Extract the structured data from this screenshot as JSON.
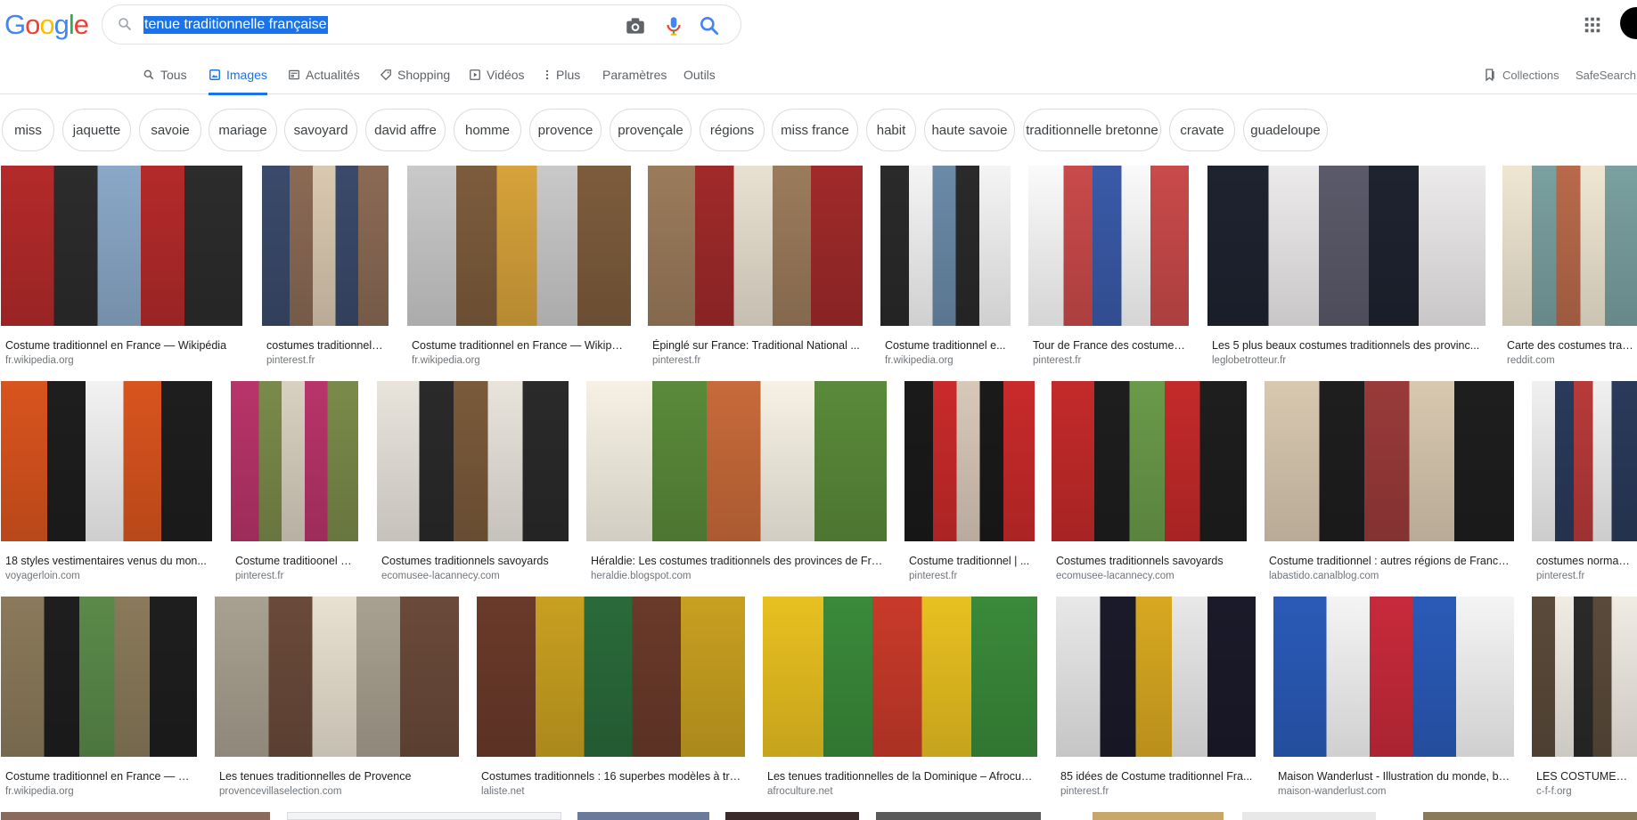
{
  "logo": {
    "text": "Google",
    "letters": [
      {
        "ch": "G",
        "color": "#4285F4"
      },
      {
        "ch": "o",
        "color": "#EA4335"
      },
      {
        "ch": "o",
        "color": "#FBBC05"
      },
      {
        "ch": "g",
        "color": "#4285F4"
      },
      {
        "ch": "l",
        "color": "#34A853"
      },
      {
        "ch": "e",
        "color": "#EA4335"
      }
    ]
  },
  "search": {
    "query": "tenue traditionnelle française",
    "icons": [
      "search-icon",
      "camera-icon",
      "microphone-icon",
      "search-submit-icon"
    ]
  },
  "tabs": [
    {
      "label": "Tous",
      "icon": "search-icon"
    },
    {
      "label": "Images",
      "icon": "image-icon",
      "active": true
    },
    {
      "label": "Actualités",
      "icon": "news-icon"
    },
    {
      "label": "Shopping",
      "icon": "tag-icon"
    },
    {
      "label": "Vidéos",
      "icon": "play-icon"
    },
    {
      "label": "Plus",
      "icon": "more-vert-icon"
    },
    {
      "label": "Paramètres"
    },
    {
      "label": "Outils"
    }
  ],
  "right_links": {
    "collections": "Collections",
    "safesearch": "SafeSearch"
  },
  "chips": [
    "miss",
    "jaquette",
    "savoie",
    "mariage",
    "savoyard",
    "david affre",
    "homme",
    "provence",
    "provençale",
    "régions",
    "miss france",
    "habit",
    "haute savoie",
    "traditionnelle bretonne",
    "cravate",
    "guadeloupe"
  ],
  "results": [
    {
      "title": "Costume traditionnel en France — Wikipédia",
      "source": "fr.wikipedia.org",
      "colors": [
        "#b42a2a",
        "#2c2c2c",
        "#8aa8c8"
      ]
    },
    {
      "title": "costumes traditionnels...",
      "source": "pinterest.fr",
      "colors": [
        "#3b4a6b",
        "#8a6a55",
        "#d9c9b0"
      ]
    },
    {
      "title": "Costume traditionnel en France — Wikipédia",
      "source": "fr.wikipedia.org",
      "colors": [
        "#c9c9c9",
        "#7d5c3c",
        "#d6a23a"
      ]
    },
    {
      "title": "Épinglé sur France: Traditional National ...",
      "source": "pinterest.fr",
      "colors": [
        "#9b7b5b",
        "#a02a2a",
        "#e8e0d0"
      ]
    },
    {
      "title": "Costume traditionnel e...",
      "source": "fr.wikipedia.org",
      "colors": [
        "#2a2a2a",
        "#f4f4f4",
        "#6a8aa8"
      ]
    },
    {
      "title": "Tour de France des costumes...",
      "source": "pinterest.fr",
      "colors": [
        "#fafafa",
        "#c94a4a",
        "#3a5aa8"
      ]
    },
    {
      "title": "Les 5 plus beaux costumes traditionnels des provinc...",
      "source": "leglobetrotteur.fr",
      "colors": [
        "#1e2330",
        "#eceaea",
        "#5a5a6a"
      ]
    },
    {
      "title": "Carte des costumes traditi...",
      "source": "reddit.com",
      "colors": [
        "#efe6d2",
        "#7aa0a0",
        "#b86a4a"
      ]
    },
    {
      "title": "18 styles vestimentaires venus du mon...",
      "source": "voyagerloin.com",
      "colors": [
        "#d9541e",
        "#1e1e1e",
        "#f2f2f2"
      ]
    },
    {
      "title": "Costume traditioonel B...",
      "source": "pinterest.fr",
      "colors": [
        "#b8346a",
        "#7a8a4a",
        "#d8d0c0"
      ]
    },
    {
      "title": "Costumes traditionnels savoyards",
      "source": "ecomusee-lacannecy.com",
      "colors": [
        "#e8e4dc",
        "#2a2a2a",
        "#7a5a3a"
      ]
    },
    {
      "title": "Héraldie: Les costumes traditionnels des provinces de Fra...",
      "source": "heraldie.blogspot.com",
      "colors": [
        "#f6f1e4",
        "#5a8a3a",
        "#c86a3a"
      ]
    },
    {
      "title": "Costume traditionnel | ...",
      "source": "pinterest.fr",
      "colors": [
        "#1a1a1a",
        "#c92a2a",
        "#d8c8b8"
      ]
    },
    {
      "title": "Costumes traditionnels savoyards",
      "source": "ecomusee-lacannecy.com",
      "colors": [
        "#c42a2a",
        "#1e1e1e",
        "#6a9a4a"
      ]
    },
    {
      "title": "Costume traditionnel : autres régions de France...",
      "source": "labastido.canalblog.com",
      "colors": [
        "#d8c8b0",
        "#1e1e1e",
        "#9a3a3a"
      ]
    },
    {
      "title": "costumes normande...",
      "source": "pinterest.fr",
      "colors": [
        "#f0f0f0",
        "#2a3a5a",
        "#b83a3a"
      ]
    },
    {
      "title": "Costume traditionnel en France — Wi...",
      "source": "fr.wikipedia.org",
      "colors": [
        "#8a7a5a",
        "#1e1e1e",
        "#5a8a4a"
      ]
    },
    {
      "title": "Les tenues traditionnelles de Provence",
      "source": "provencevillaselection.com",
      "colors": [
        "#a8a090",
        "#6a4a3a",
        "#e8e0d0"
      ]
    },
    {
      "title": "Costumes traditionnels : 16 superbes modèles à tra...",
      "source": "laliste.net",
      "colors": [
        "#6a3a2a",
        "#c8a020",
        "#2a6a3a"
      ]
    },
    {
      "title": "Les tenues traditionnelles de la Dominique – Afrocult...",
      "source": "afroculture.net",
      "colors": [
        "#e8c020",
        "#3a8a3a",
        "#c83a2a"
      ]
    },
    {
      "title": "85 idées de Costume traditionnel Fra...",
      "source": "pinterest.fr",
      "colors": [
        "#e8e8e8",
        "#1a1a2a",
        "#d8a820"
      ]
    },
    {
      "title": "Maison Wanderlust - Illustration du monde, bo...",
      "source": "maison-wanderlust.com",
      "colors": [
        "#2a5ab8",
        "#f4f4f4",
        "#c82a3a"
      ]
    },
    {
      "title": "LES COSTUMES TRA...",
      "source": "c-f-f.org",
      "colors": [
        "#5a4a3a",
        "#f0ece4",
        "#2a2a2a"
      ]
    }
  ]
}
